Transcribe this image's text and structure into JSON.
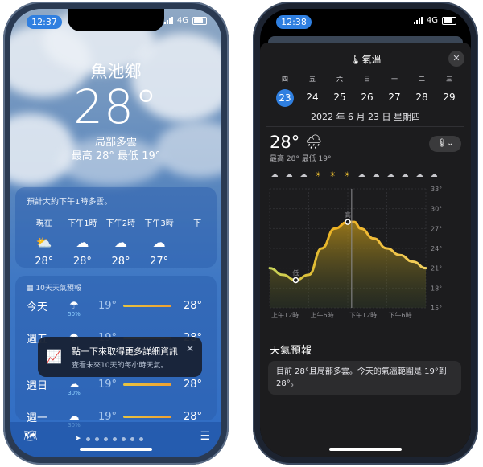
{
  "left": {
    "status": {
      "time": "12:37",
      "network": "4G"
    },
    "city": "魚池鄉",
    "temperature": "28°",
    "condition": "局部多雲",
    "high_low": "最高 28°  最低 19°",
    "hourly": {
      "summary": "預計大約下午1時多雲。",
      "hours": [
        {
          "time": "現在",
          "icon": "partly-sunny-icon",
          "glyph": "⛅",
          "temp": "28°"
        },
        {
          "time": "下午1時",
          "icon": "cloud-icon",
          "glyph": "☁",
          "temp": "28°"
        },
        {
          "time": "下午2時",
          "icon": "cloud-icon",
          "glyph": "☁",
          "temp": "28°"
        },
        {
          "time": "下午3時",
          "icon": "cloud-icon",
          "glyph": "☁",
          "temp": "27°"
        },
        {
          "time": "下",
          "icon": "",
          "glyph": "",
          "temp": ""
        }
      ]
    },
    "daily": {
      "title": "10天天氣預報",
      "days": [
        {
          "day": "今天",
          "glyph": "☂",
          "precip": "50%",
          "low": "19°",
          "high": "28°"
        },
        {
          "day": "週五",
          "glyph": "☂",
          "precip": "",
          "low": "19°",
          "high": "28°"
        },
        {
          "day": "週日",
          "glyph": "☁",
          "precip": "30%",
          "low": "19°",
          "high": "28°"
        },
        {
          "day": "週一",
          "glyph": "☁",
          "precip": "30%",
          "low": "19°",
          "high": "28°"
        }
      ]
    },
    "toast": {
      "title": "點一下來取得更多詳細資訊",
      "subtitle": "查看未來10天的每小時天氣。"
    }
  },
  "right": {
    "status": {
      "time": "12:38",
      "network": "4G"
    },
    "title": "氣溫",
    "weekdays": [
      "四",
      "五",
      "六",
      "日",
      "一",
      "二",
      "三"
    ],
    "dates": [
      "23",
      "24",
      "25",
      "26",
      "27",
      "28",
      "29"
    ],
    "selected_date_index": 0,
    "full_date": "2022 年 6 月 23 日 星期四",
    "current_temp": "28°",
    "high_low": "最高 28° 最低 19°",
    "unit_button": "🌡⌄",
    "forecast_heading": "天氣預報",
    "forecast_text": "目前 28°且局部多雲。今天的氣溫範圍是 19°到 28°。"
  },
  "chart_data": {
    "type": "area",
    "x": [
      0,
      2,
      4,
      6,
      8,
      10,
      12,
      13,
      14,
      16,
      18,
      20,
      22,
      24
    ],
    "y": [
      21,
      20,
      19.2,
      20,
      24,
      27,
      28,
      28,
      27,
      25.5,
      24,
      23,
      22,
      21
    ],
    "y_ticks": [
      "33°",
      "30°",
      "27°",
      "24°",
      "21°",
      "18°",
      "15°"
    ],
    "ylim": [
      15,
      33
    ],
    "x_ticks": [
      "上午12時",
      "上午6時",
      "下午12時",
      "下午6時"
    ],
    "annotations": [
      {
        "label": "高",
        "x": 12,
        "y": 28
      },
      {
        "label": "低",
        "x": 4,
        "y": 19.2
      }
    ],
    "now_marker_x": 12.6
  }
}
